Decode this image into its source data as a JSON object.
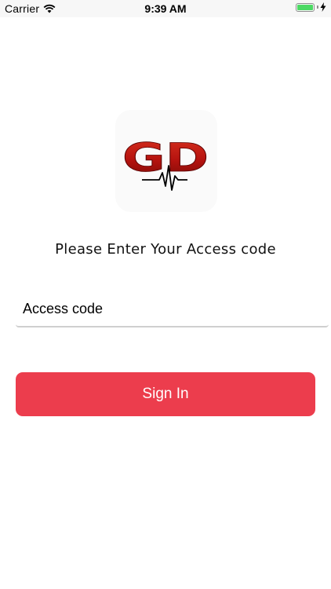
{
  "status_bar": {
    "carrier": "Carrier",
    "time": "9:39 AM",
    "battery_level": 1.0
  },
  "logo": {
    "text": "GD"
  },
  "login": {
    "prompt": "Please Enter Your Access code",
    "access_code_placeholder": "Access code",
    "access_code_value": "",
    "sign_in_label": "Sign In"
  },
  "colors": {
    "button": "#ec3d4d",
    "logo_red": "#b8140f",
    "battery": "#4cd964"
  }
}
